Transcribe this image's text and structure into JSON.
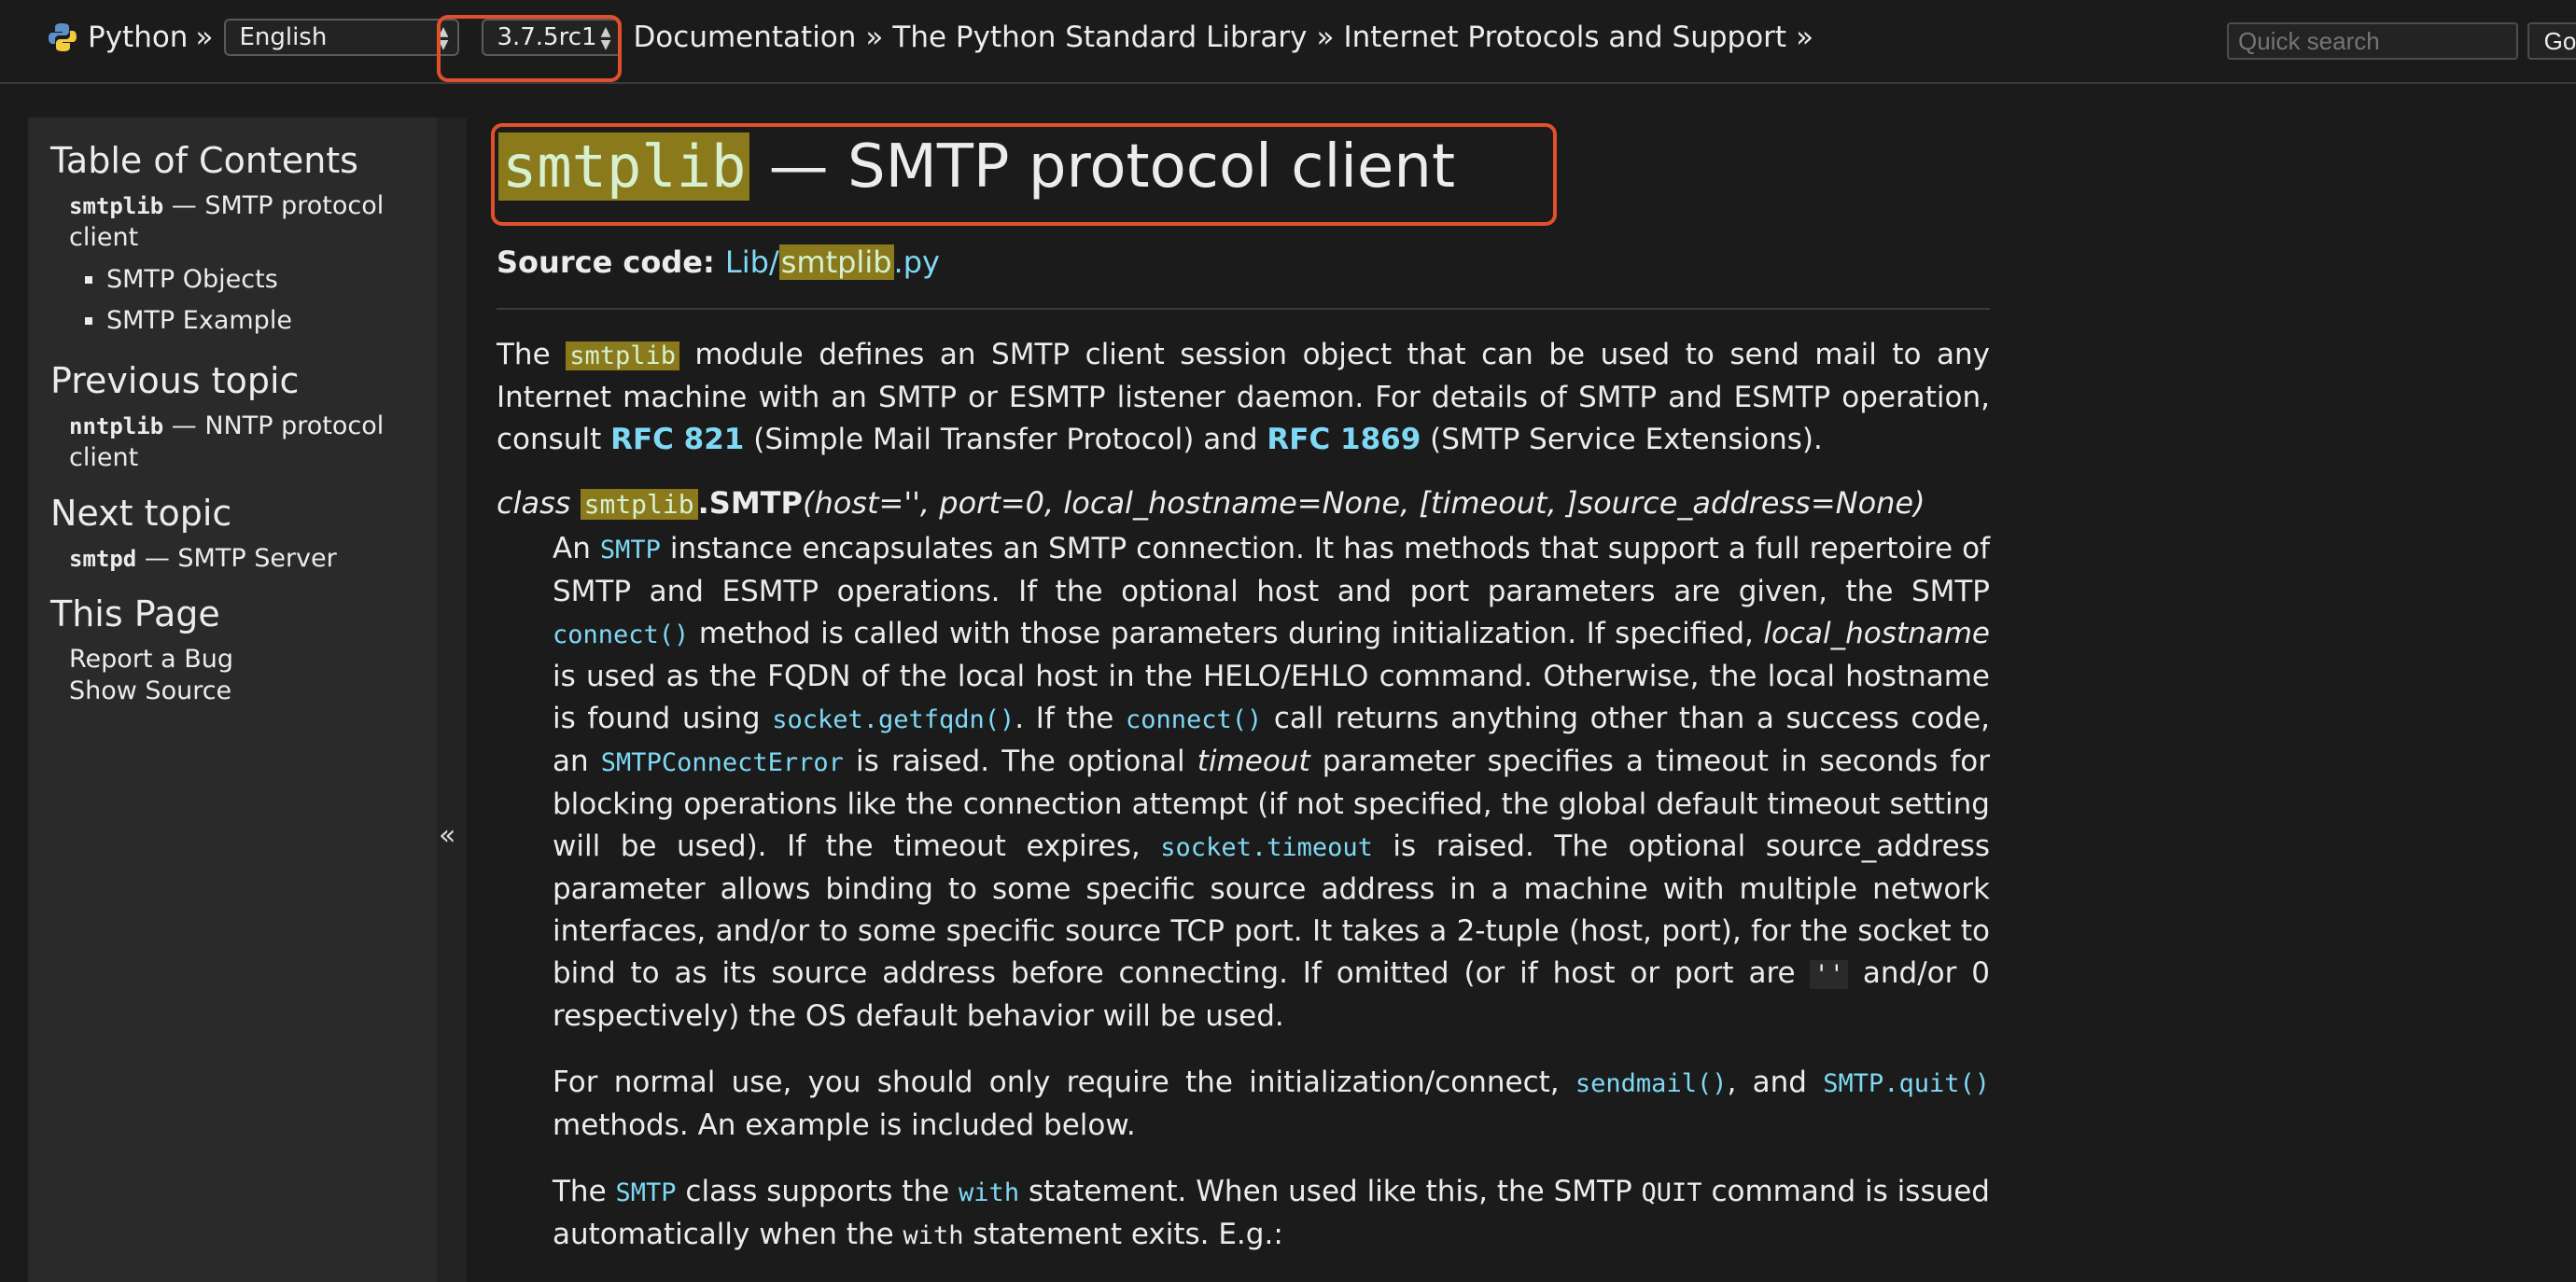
{
  "topbar": {
    "python_label": "Python",
    "sep": "»",
    "language_value": "English",
    "version_value": "3.7.5rc1",
    "breadcrumb_documentation": "Documentation",
    "breadcrumb_stdlib": "The Python Standard Library",
    "breadcrumb_internet": "Internet Protocols and Support",
    "search_placeholder": "Quick search",
    "go_label": "Go"
  },
  "sidebar": {
    "toc_heading": "Table of Contents",
    "toc_main_mono": "smtplib",
    "toc_main_rest": " — SMTP protocol client",
    "toc_items": [
      "SMTP Objects",
      "SMTP Example"
    ],
    "prev_heading": "Previous topic",
    "prev_mono": "nntplib",
    "prev_rest": " — NNTP protocol client",
    "next_heading": "Next topic",
    "next_mono": "smtpd",
    "next_rest": " — SMTP Server",
    "this_page_heading": "This Page",
    "report_bug": "Report a Bug",
    "show_source": "Show Source",
    "collapse_glyph": "«"
  },
  "main": {
    "title_mono": "smtplib",
    "title_rest": " — SMTP protocol client",
    "source_label": "Source code:",
    "source_link_a": "Lib/",
    "source_link_b": "smtplib",
    "source_link_c": ".py",
    "intro_1": "The ",
    "intro_mono": "smtplib",
    "intro_2": " module defines an SMTP client session object that can be used to send mail to any Internet machine with an SMTP or ESMTP listener daemon. For details of SMTP and ESMTP operation, consult ",
    "rfc821": "RFC 821",
    "intro_3": " (Simple Mail Transfer Protocol) and ",
    "rfc1869": "RFC 1869",
    "intro_4": " (SMTP Service Extensions).",
    "sig_class": "class ",
    "sig_module": "smtplib",
    "sig_dot": ".",
    "sig_name": "SMTP",
    "sig_params": "(host='', port=0, local_hostname=None, [timeout, ]source_address=None)",
    "p1_a": "An ",
    "p1_smtp": "SMTP",
    "p1_b": " instance encapsulates an SMTP connection. It has methods that support a full repertoire of SMTP and ESMTP operations. If the optional host and port parameters are given, the SMTP ",
    "p1_connect": "connect()",
    "p1_c": " method is called with those parameters during initialization. If specified, ",
    "p1_lh": "local_hostname",
    "p1_d": " is used as the FQDN of the local host in the HELO/EHLO command. Otherwise, the local hostname is found using ",
    "p1_getfqdn": "socket.getfqdn()",
    "p1_e": ". If the ",
    "p1_connect2": "connect()",
    "p1_f": " call returns anything other than a success code, an ",
    "p1_err": "SMTPConnectError",
    "p1_g": " is raised. The optional ",
    "p1_timeout": "timeout",
    "p1_h": " parameter specifies a timeout in seconds for blocking operations like the connection attempt (if not specified, the global default timeout setting will be used). If the timeout expires, ",
    "p1_sockto": "socket.timeout",
    "p1_i": " is raised. The optional source_address parameter allows binding to some specific source address in a machine with multiple network interfaces, and/or to some specific source TCP port. It takes a 2-tuple (host, port), for the socket to bind to as its source address before connecting. If omitted (or if host or port are ",
    "p1_empty": "''",
    "p1_j": " and/or 0 respectively) the OS default behavior will be used.",
    "p2_a": "For normal use, you should only require the initialization/connect, ",
    "p2_sendmail": "sendmail()",
    "p2_b": ", and ",
    "p2_quit": "SMTP.quit()",
    "p2_c": " methods. An example is included below.",
    "p3_a": "The ",
    "p3_smtp": "SMTP",
    "p3_b": " class supports the ",
    "p3_with": "with",
    "p3_c": " statement. When used like this, the SMTP ",
    "p3_quit": "QUIT",
    "p3_d": " command is issued automatically when the ",
    "p3_with2": "with",
    "p3_e": " statement exits. E.g.:"
  }
}
